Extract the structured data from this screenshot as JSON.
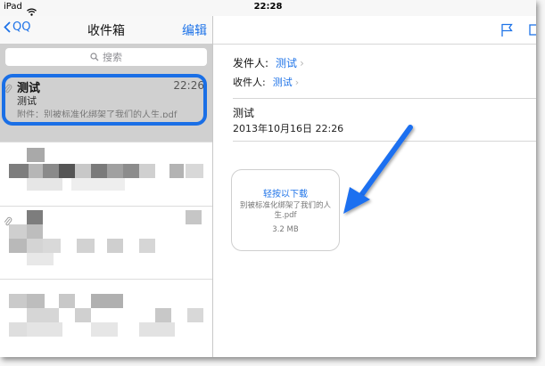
{
  "status": {
    "device": "iPad",
    "time": "22:28"
  },
  "left_nav": {
    "back_label": "QQ",
    "title": "收件箱",
    "edit_label": "编辑"
  },
  "search": {
    "placeholder": "搜索"
  },
  "selected_mail": {
    "sender": "测试",
    "time": "22:26",
    "subject": "测试",
    "preview": "附件：别被标准化绑架了我们的人生.pdf"
  },
  "detail": {
    "from_label": "发件人:",
    "from_value": "测试",
    "to_label": "收件人:",
    "to_value": "测试",
    "subject": "测试",
    "date": "2013年10月16日 22:26"
  },
  "attachment": {
    "action": "轻按以下载",
    "filename": "别被标准化绑架了我们的人生.pdf",
    "size": "3.2 MB"
  },
  "icons": [
    "wifi-icon",
    "back-chevron-icon",
    "search-icon",
    "paperclip-icon",
    "flag-icon",
    "arrow-icon"
  ],
  "colors": {
    "accent": "#1e73e8",
    "highlight": "#1a6fe6",
    "arrow": "#1f6ff0"
  }
}
